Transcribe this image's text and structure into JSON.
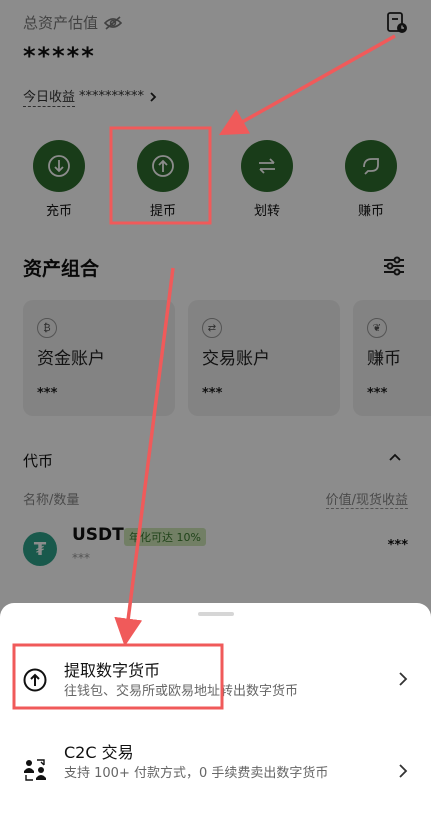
{
  "header": {
    "total_label": "总资产估值",
    "balance": "*****",
    "today_label": "今日收益",
    "today_value": "**********"
  },
  "actions": [
    {
      "label": "充币"
    },
    {
      "label": "提币"
    },
    {
      "label": "划转"
    },
    {
      "label": "赚币"
    }
  ],
  "portfolio": {
    "title": "资产组合",
    "cards": [
      {
        "name": "资金账户",
        "value": "***"
      },
      {
        "name": "交易账户",
        "value": "***"
      },
      {
        "name": "赚币",
        "value": "***"
      }
    ]
  },
  "coins": {
    "title": "代币",
    "col_left": "名称/数量",
    "col_right": "价值/现货收益",
    "items": [
      {
        "symbol": "USDT",
        "badge": "年化可达 10%",
        "amount": "***",
        "value": "***"
      }
    ]
  },
  "sheet": {
    "options": [
      {
        "title": "提取数字货币",
        "desc": "往钱包、交易所或欧易地址转出数字货币"
      },
      {
        "title": "C2C 交易",
        "desc": "支持 100+ 付款方式，0 手续费卖出数字货币"
      }
    ]
  },
  "colors": {
    "action_green": "#2f6e2f",
    "annotation_red": "#f05a5a",
    "tether_green": "#2ea38a"
  }
}
